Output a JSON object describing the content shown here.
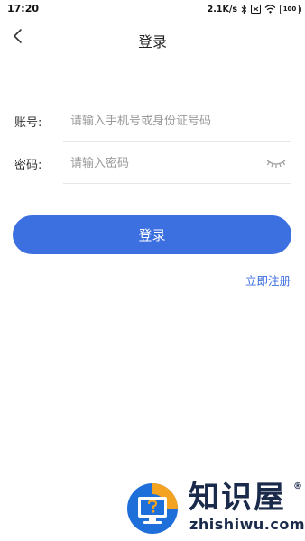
{
  "status_bar": {
    "time": "17:20",
    "network_speed": "2.1K/s",
    "battery": "100",
    "icons": [
      "bluetooth-icon",
      "sim-off-icon",
      "wifi-icon",
      "battery-icon"
    ]
  },
  "nav": {
    "title": "登录",
    "back_icon": "chevron-left-icon"
  },
  "form": {
    "account": {
      "label": "账号:",
      "placeholder": "请输入手机号或身份证号码",
      "value": ""
    },
    "password": {
      "label": "密码:",
      "placeholder": "请输入密码",
      "value": "",
      "toggle_icon": "eye-closed-icon"
    }
  },
  "actions": {
    "login_label": "登录",
    "register_label": "立即注册"
  },
  "watermark": {
    "brand_cn": "知识屋",
    "brand_en": "zhishiwu.com",
    "registered": "®"
  },
  "colors": {
    "accent": "#3c6fe0",
    "watermark_blue": "#1e6fd9",
    "watermark_orange": "#f4a320"
  }
}
